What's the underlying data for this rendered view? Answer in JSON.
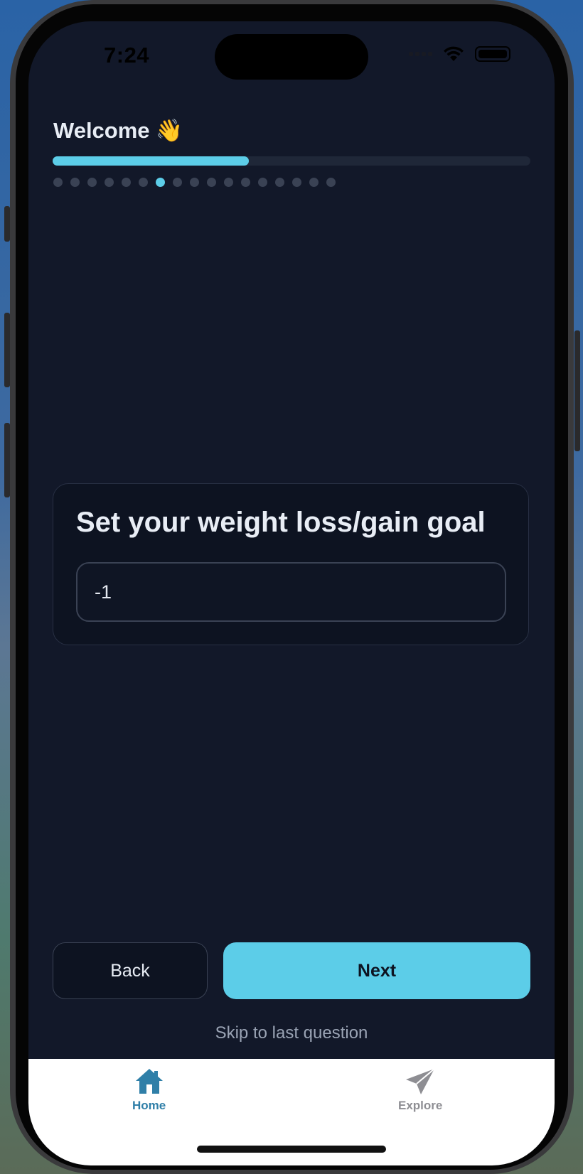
{
  "status_bar": {
    "time": "7:24"
  },
  "header": {
    "title": "Welcome",
    "emoji": "👋"
  },
  "progress": {
    "fraction": 0.41,
    "steps_total": 17,
    "current_step": 7
  },
  "question": {
    "title": "Set your weight loss/gain goal",
    "input_value": "-1"
  },
  "actions": {
    "back_label": "Back",
    "next_label": "Next",
    "skip_label": "Skip to last question"
  },
  "tabs": [
    {
      "label": "Home",
      "icon": "house-icon",
      "active": true
    },
    {
      "label": "Explore",
      "icon": "paper-plane-icon",
      "active": false
    }
  ],
  "colors": {
    "accent": "#5ccde8",
    "background": "#121829",
    "tab_active": "#2f7fa8",
    "tab_inactive": "#8e8e93"
  }
}
